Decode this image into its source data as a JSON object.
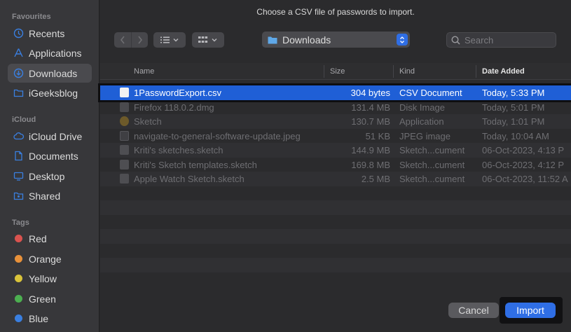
{
  "dialog": {
    "title": "Choose a CSV file of passwords to import.",
    "location": "Downloads",
    "search_placeholder": "Search",
    "cancel_label": "Cancel",
    "import_label": "Import"
  },
  "sidebar": {
    "favourites_header": "Favourites",
    "favourites": [
      {
        "label": "Recents",
        "icon": "clock-icon"
      },
      {
        "label": "Applications",
        "icon": "applications-icon"
      },
      {
        "label": "Downloads",
        "icon": "download-icon",
        "selected": true
      },
      {
        "label": "iGeeksblog",
        "icon": "folder-icon"
      }
    ],
    "icloud_header": "iCloud",
    "icloud": [
      {
        "label": "iCloud Drive",
        "icon": "cloud-icon"
      },
      {
        "label": "Documents",
        "icon": "document-icon"
      },
      {
        "label": "Desktop",
        "icon": "desktop-icon"
      },
      {
        "label": "Shared",
        "icon": "shared-folder-icon"
      }
    ],
    "tags_header": "Tags",
    "tags": [
      {
        "label": "Red",
        "color": "#d9534f"
      },
      {
        "label": "Orange",
        "color": "#e8913a"
      },
      {
        "label": "Yellow",
        "color": "#d9c33a"
      },
      {
        "label": "Green",
        "color": "#4caf50"
      },
      {
        "label": "Blue",
        "color": "#3a7fe0"
      }
    ]
  },
  "columns": {
    "name": "Name",
    "size": "Size",
    "kind": "Kind",
    "date": "Date Added"
  },
  "files": [
    {
      "name": "1PasswordExport.csv",
      "size": "304 bytes",
      "kind": "CSV Document",
      "date": "Today, 5:33 PM",
      "selected": true
    },
    {
      "name": "Firefox 118.0.2.dmg",
      "size": "131.4 MB",
      "kind": "Disk Image",
      "date": "Today, 5:01 PM"
    },
    {
      "name": "Sketch",
      "size": "130.7 MB",
      "kind": "Application",
      "date": "Today, 1:01 PM"
    },
    {
      "name": "navigate-to-general-software-update.jpeg",
      "size": "51 KB",
      "kind": "JPEG image",
      "date": "Today, 10:04 AM"
    },
    {
      "name": "Kriti's sketches.sketch",
      "size": "144.9 MB",
      "kind": "Sketch...cument",
      "date": "06-Oct-2023, 4:13 P"
    },
    {
      "name": "Kriti's Sketch templates.sketch",
      "size": "169.8 MB",
      "kind": "Sketch...cument",
      "date": "06-Oct-2023, 4:12 P"
    },
    {
      "name": "Apple Watch Sketch.sketch",
      "size": "2.5 MB",
      "kind": "Sketch...cument",
      "date": "06-Oct-2023, 11:52 A"
    }
  ]
}
